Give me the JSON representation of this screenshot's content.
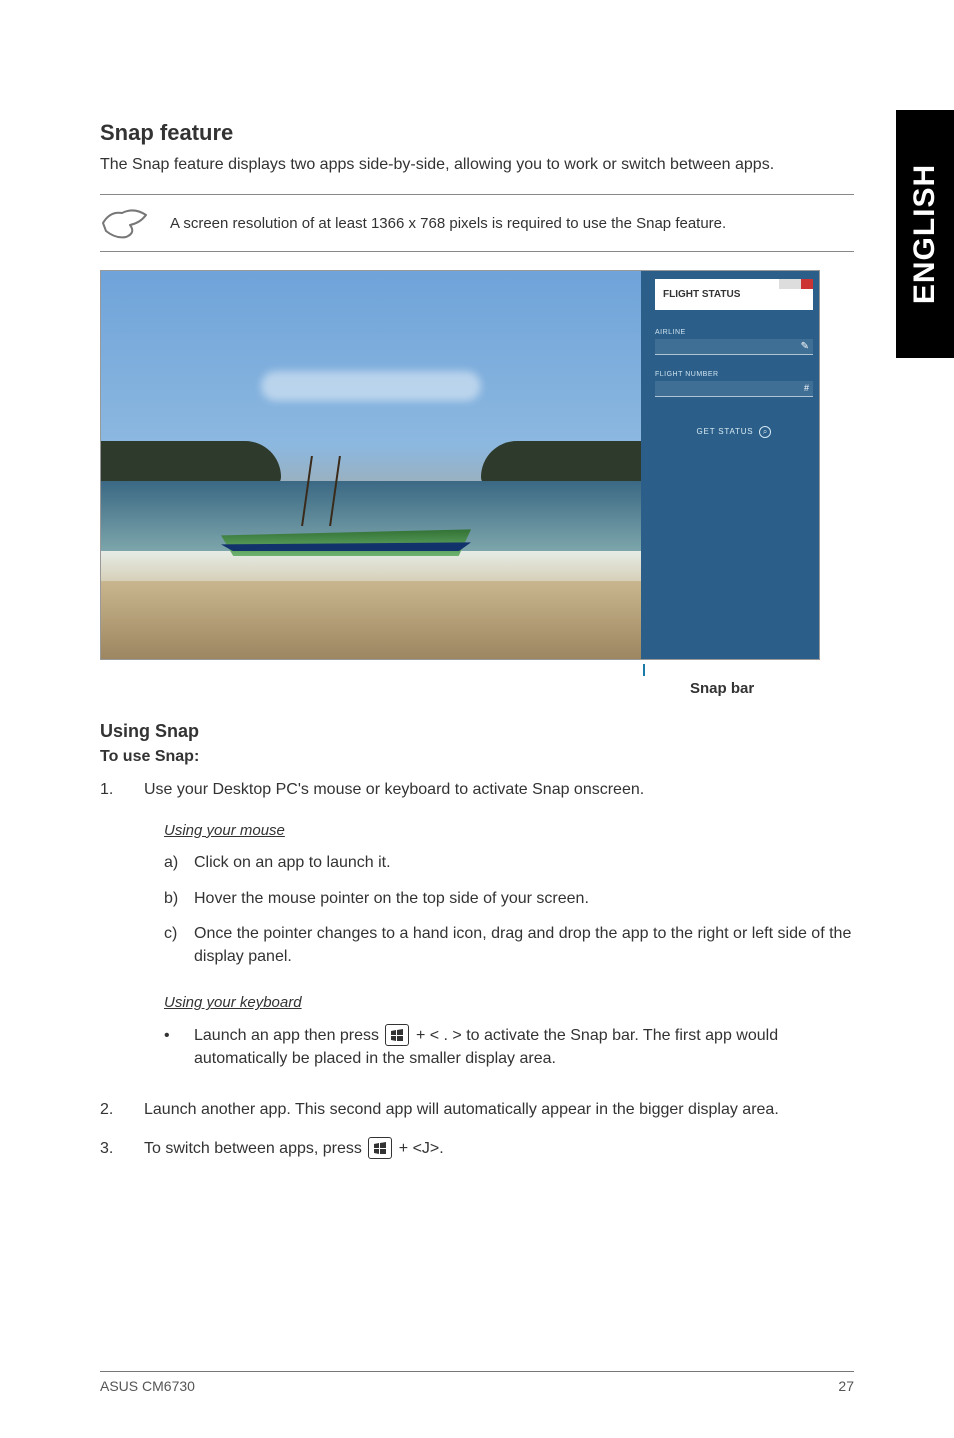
{
  "sideTab": "ENGLISH",
  "snapFeature": {
    "title": "Snap feature",
    "intro": "The Snap feature displays two apps side-by-side, allowing you to work or switch between apps.",
    "note": "A screen resolution of at least 1366 x 768 pixels is required to use the Snap feature."
  },
  "screenshot": {
    "rightPanel": {
      "title": "FLIGHT STATUS",
      "airlineLabel": "AIRLINE",
      "flightLabel": "FLIGHT NUMBER",
      "hash": "#",
      "getStatus": "GET STATUS"
    },
    "snapBarLabel": "Snap bar"
  },
  "usingSnap": {
    "title": "Using Snap",
    "toUse": "To use Snap:",
    "step1": {
      "text": "Use your Desktop PC's mouse or keyboard to activate Snap onscreen.",
      "mouseHeading": "Using your mouse",
      "mouseA": "Click on an app to launch it.",
      "mouseB": "Hover the mouse pointer on the top side of your screen.",
      "mouseC": "Once the pointer changes to a hand icon, drag and drop the app to the right or left side of the display panel.",
      "keyboardHeading": "Using your keyboard",
      "keyboardBulletPre": "Launch an app then press ",
      "keyboardBulletPost": " + < . > to activate the Snap bar. The first app would automatically be placed in the smaller display area."
    },
    "step2": "Launch another app. This second app will automatically appear in the bigger display area.",
    "step3Pre": "To switch between apps, press ",
    "step3Post": " + <J>."
  },
  "footer": {
    "left": "ASUS CM6730",
    "right": "27"
  }
}
